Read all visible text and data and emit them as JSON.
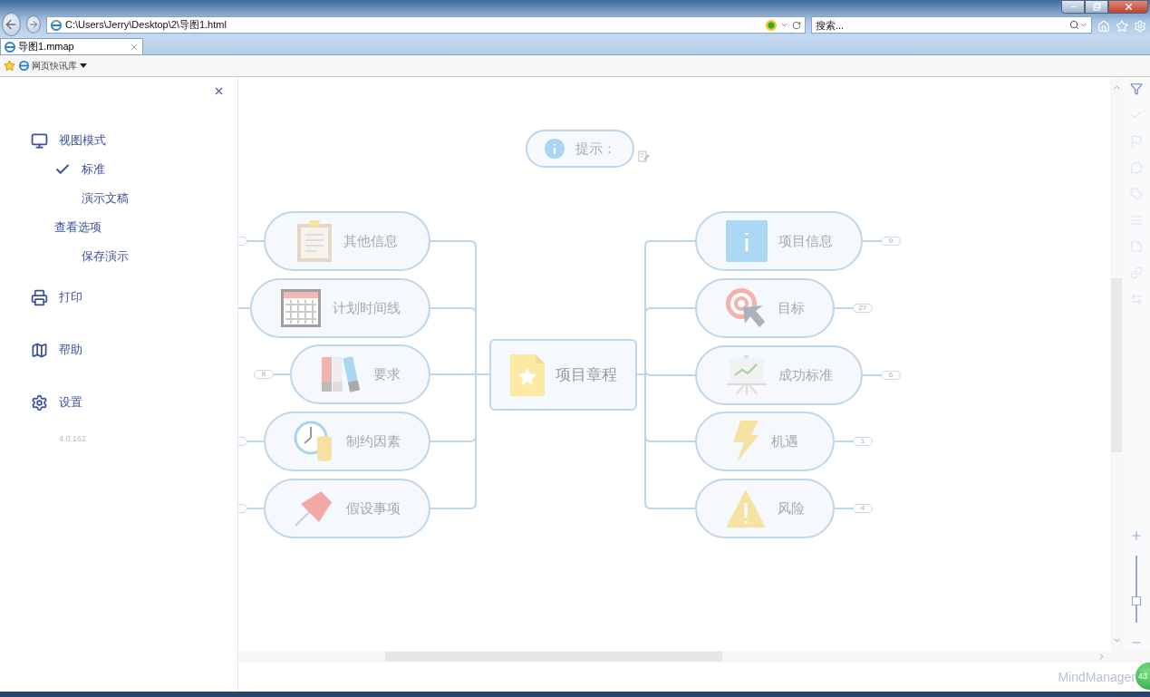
{
  "browser": {
    "address": "C:\\Users\\Jerry\\Desktop\\2\\导图1.html",
    "search": {
      "placeholder": "搜索..."
    },
    "tabs": [
      {
        "label": "导图1.mmap",
        "selected": true
      }
    ],
    "favorites": [
      {
        "label": "网页快讯库"
      }
    ]
  },
  "menu": {
    "items": [
      {
        "kind": "view",
        "label": "视图模式"
      },
      {
        "kind": "option",
        "label": "标准",
        "selected": true
      },
      {
        "kind": "option",
        "label": "演示文稿",
        "selected": false
      },
      {
        "kind": "subheading",
        "label": "查看选项"
      },
      {
        "kind": "subitem",
        "label": "保存演示"
      },
      {
        "kind": "print",
        "label": "打印"
      },
      {
        "kind": "help",
        "label": "帮助"
      },
      {
        "kind": "settings",
        "label": "设置"
      }
    ],
    "version": "4.0.162"
  },
  "mindmap": {
    "tip": {
      "label": "提示："
    },
    "center": {
      "kind": "document",
      "label": "项目章程"
    },
    "left_topics": [
      {
        "kind": "clipboard",
        "label": "其他信息",
        "badge_hidden": true
      },
      {
        "kind": "calendar",
        "label": "计划时间线"
      },
      {
        "kind": "binders",
        "label": "要求",
        "badge": "8"
      },
      {
        "kind": "clock",
        "label": "制约因素",
        "badge_hidden": true
      },
      {
        "kind": "pin",
        "label": "假设事项",
        "badge_hidden": true
      }
    ],
    "right_topics": [
      {
        "kind": "info",
        "label": "项目信息",
        "badge": "9"
      },
      {
        "kind": "target",
        "label": "目标",
        "badge": "27"
      },
      {
        "kind": "chart",
        "label": "成功标准",
        "badge": "6"
      },
      {
        "kind": "bolt",
        "label": "机遇",
        "badge": "1"
      },
      {
        "kind": "warning",
        "label": "风险",
        "badge": "4"
      }
    ]
  },
  "zoom": {
    "level": 0.3
  },
  "brand": "MindManager",
  "overlay_badge": "43"
}
